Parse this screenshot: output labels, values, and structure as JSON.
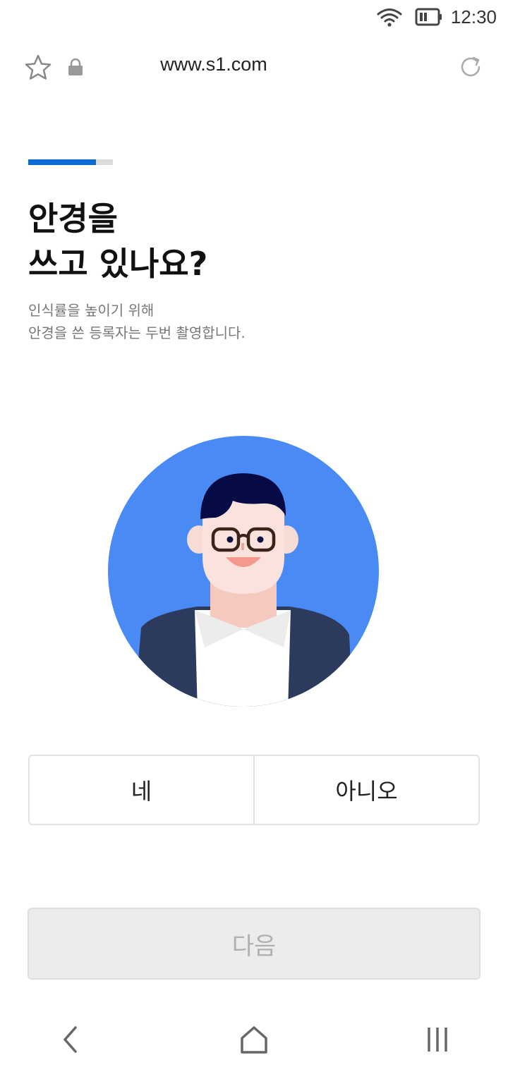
{
  "status_bar": {
    "time": "12:30",
    "icons": [
      "wifi-icon",
      "battery-icon"
    ]
  },
  "browser": {
    "url": "www.s1.com",
    "icons": [
      "star-icon",
      "lock-icon",
      "reload-icon"
    ]
  },
  "step": {
    "progress": 0.8,
    "accent_color": "#0b6bd0"
  },
  "question": {
    "title_line1": "안경을",
    "title_line2": "쓰고 있나요?",
    "desc_line1": "인식률을 높이기 위해",
    "desc_line2": "안경을 쓴 등록자는 두번 촬영합니다."
  },
  "illustration": {
    "name": "person-with-glasses-avatar",
    "background_color": "#4a8af4"
  },
  "choices": {
    "yes_label": "네",
    "no_label": "아니오"
  },
  "next_button": {
    "label": "다음",
    "state": "disabled"
  },
  "nav_bar": {
    "icons": [
      "back-icon",
      "home-icon",
      "recents-icon"
    ]
  }
}
